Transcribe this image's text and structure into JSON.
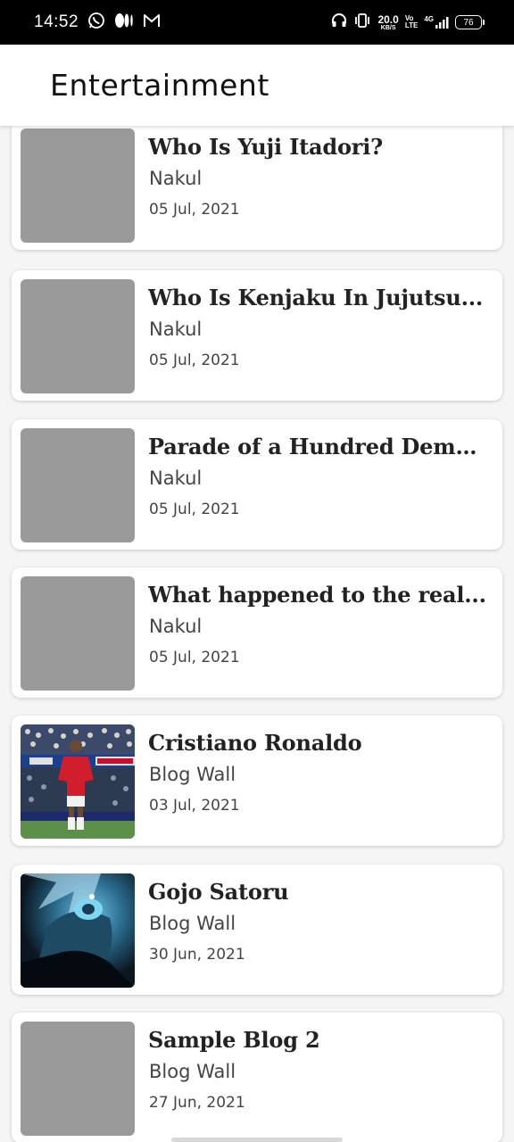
{
  "status_bar": {
    "time": "14:52",
    "net_speed_value": "20.0",
    "net_speed_unit": "KB/S",
    "volte_top": "Vo",
    "volte_bottom": "LTE",
    "network": "4G",
    "battery": "76",
    "icons": [
      "whatsapp-icon",
      "medium-icon",
      "gmail-icon",
      "headphones-icon",
      "vibrate-icon",
      "signal-icon",
      "battery-icon"
    ]
  },
  "app_bar": {
    "title": "Entertainment"
  },
  "posts": [
    {
      "title": "Who Is Yuji Itadori?",
      "author": "Nakul",
      "date": "05 Jul, 2021",
      "thumbnail": "placeholder"
    },
    {
      "title": "Who Is Kenjaku In Jujutsu...",
      "author": "Nakul",
      "date": "05 Jul, 2021",
      "thumbnail": "placeholder"
    },
    {
      "title": "Parade of a Hundred Demo...",
      "author": "Nakul",
      "date": "05 Jul, 2021",
      "thumbnail": "placeholder"
    },
    {
      "title": "What happened to the real...",
      "author": "Nakul",
      "date": "05 Jul, 2021",
      "thumbnail": "placeholder"
    },
    {
      "title": "Cristiano Ronaldo",
      "author": "Blog Wall",
      "date": "03 Jul, 2021",
      "thumbnail": "football-player-photo"
    },
    {
      "title": "Gojo Satoru",
      "author": "Blog Wall",
      "date": "30 Jun, 2021",
      "thumbnail": "anime-character-artwork"
    },
    {
      "title": "Sample Blog 2",
      "author": "Blog Wall",
      "date": "27 Jun, 2021",
      "thumbnail": "placeholder"
    }
  ],
  "colors": {
    "status_bar_bg": "#000000",
    "app_bar_bg": "#ffffff",
    "page_bg": "#f5f5f5",
    "placeholder_thumb": "#9a9a9a"
  }
}
